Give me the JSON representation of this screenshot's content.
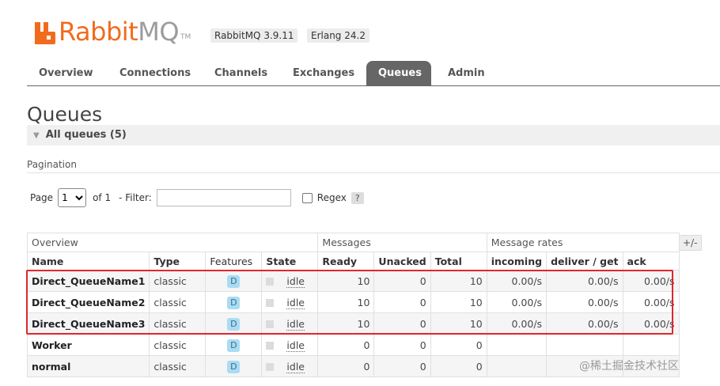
{
  "header": {
    "logo_rabbit": "Rabbit",
    "logo_mq": "MQ",
    "logo_tm": "TM",
    "version_rabbitmq": "RabbitMQ 3.9.11",
    "version_erlang": "Erlang 24.2"
  },
  "tabs": [
    {
      "label": "Overview",
      "active": false
    },
    {
      "label": "Connections",
      "active": false
    },
    {
      "label": "Channels",
      "active": false
    },
    {
      "label": "Exchanges",
      "active": false
    },
    {
      "label": "Queues",
      "active": true
    },
    {
      "label": "Admin",
      "active": false
    }
  ],
  "page": {
    "title": "Queues",
    "section_label": "All queues (5)",
    "pagination_label": "Pagination"
  },
  "pager": {
    "page_label": "Page",
    "page_value": "1",
    "of_label": "of 1",
    "filter_label": "- Filter:",
    "filter_value": "",
    "regex_label": "Regex",
    "help_label": "?"
  },
  "table": {
    "group_overview": "Overview",
    "group_messages": "Messages",
    "group_rates": "Message rates",
    "plus_minus": "+/-",
    "columns": {
      "name": "Name",
      "type": "Type",
      "features": "Features",
      "state": "State",
      "ready": "Ready",
      "unacked": "Unacked",
      "total": "Total",
      "incoming": "incoming",
      "deliver_get": "deliver / get",
      "ack": "ack"
    },
    "rows": [
      {
        "name": "Direct_QueueName1",
        "type": "classic",
        "feature": "D",
        "state": "idle",
        "ready": "10",
        "unacked": "0",
        "total": "10",
        "incoming": "0.00/s",
        "deliver_get": "0.00/s",
        "ack": "0.00/s"
      },
      {
        "name": "Direct_QueueName2",
        "type": "classic",
        "feature": "D",
        "state": "idle",
        "ready": "10",
        "unacked": "0",
        "total": "10",
        "incoming": "0.00/s",
        "deliver_get": "0.00/s",
        "ack": "0.00/s"
      },
      {
        "name": "Direct_QueueName3",
        "type": "classic",
        "feature": "D",
        "state": "idle",
        "ready": "10",
        "unacked": "0",
        "total": "10",
        "incoming": "0.00/s",
        "deliver_get": "0.00/s",
        "ack": "0.00/s"
      },
      {
        "name": "Worker",
        "type": "classic",
        "feature": "D",
        "state": "idle",
        "ready": "0",
        "unacked": "0",
        "total": "0",
        "incoming": "",
        "deliver_get": "",
        "ack": ""
      },
      {
        "name": "normal",
        "type": "classic",
        "feature": "D",
        "state": "idle",
        "ready": "0",
        "unacked": "0",
        "total": "0",
        "incoming": "",
        "deliver_get": "",
        "ack": ""
      }
    ]
  },
  "watermark": "@稀土掘金技术社区",
  "colors": {
    "brand_orange": "#f26b1d",
    "tab_active": "#666666",
    "feature_badge": "#aadcf4",
    "highlight_red": "#e0262c"
  }
}
